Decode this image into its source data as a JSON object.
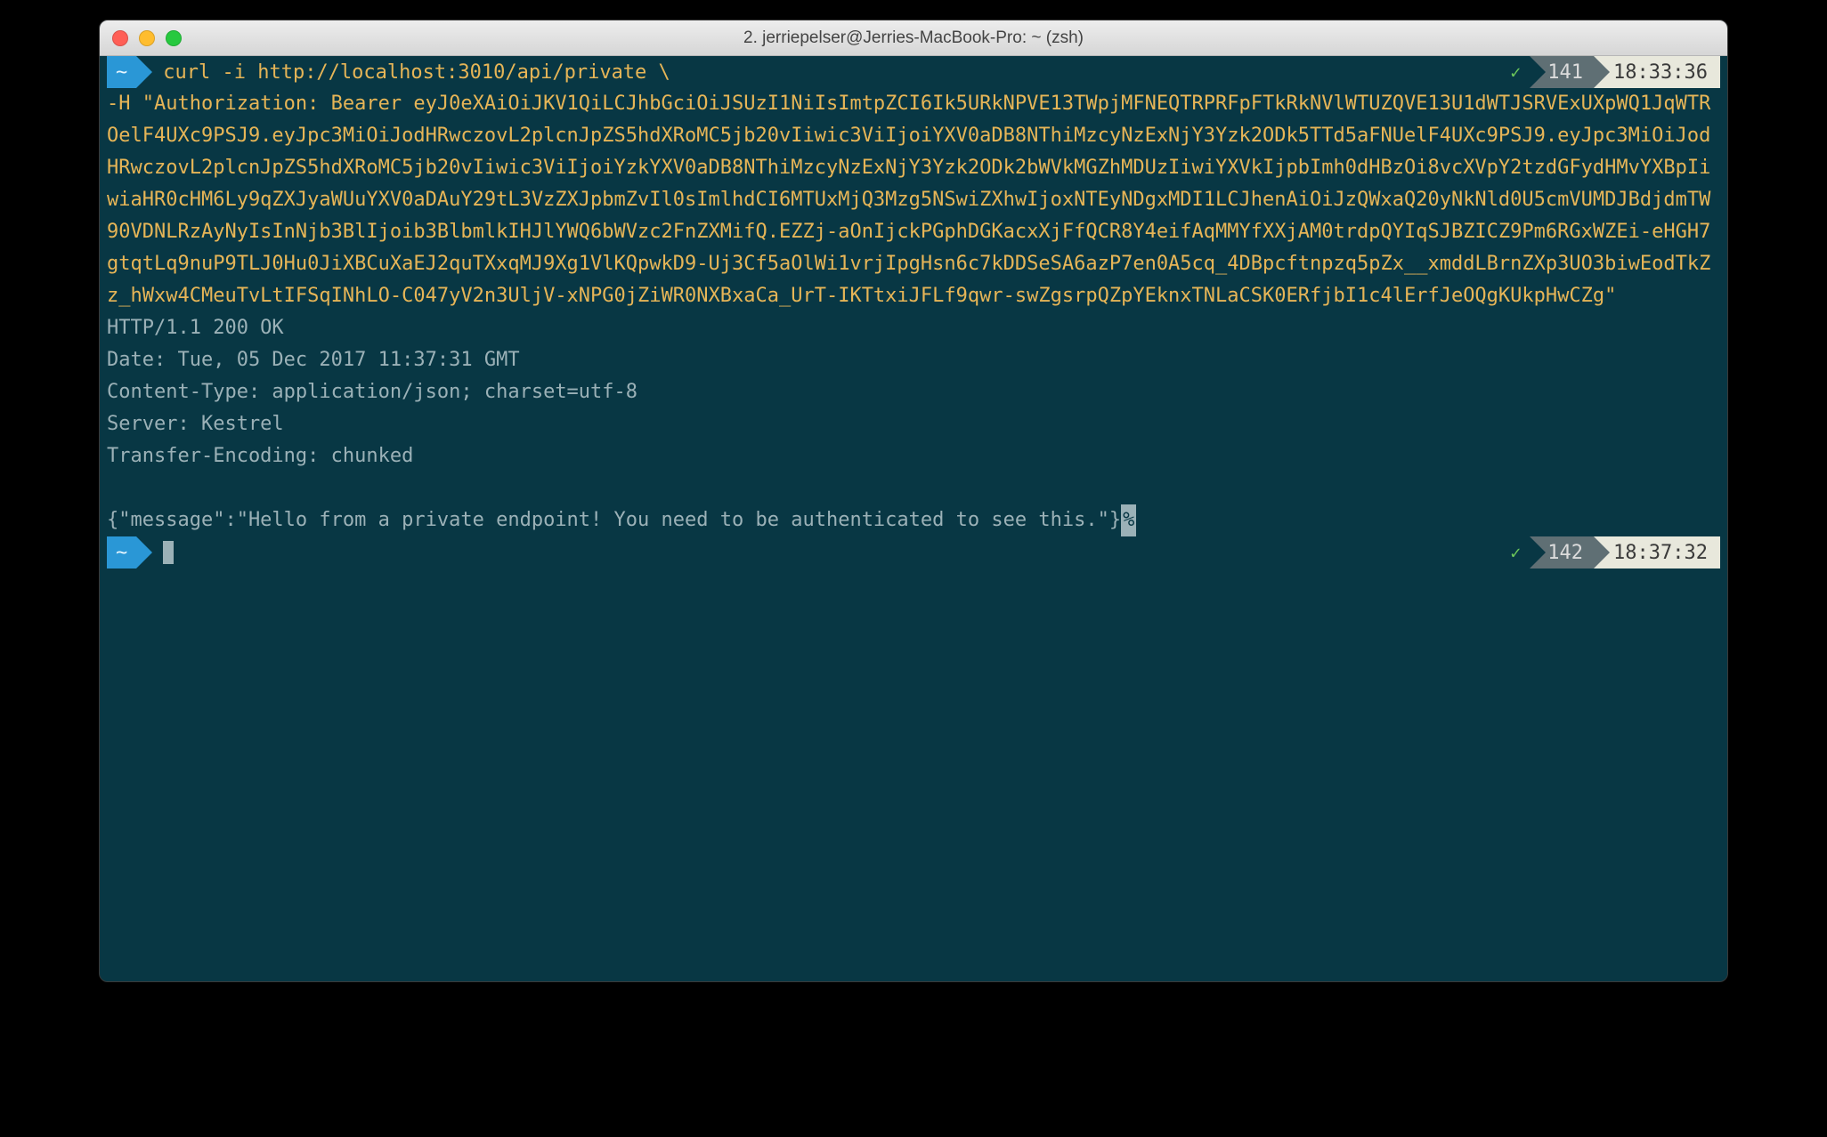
{
  "window": {
    "title": "2. jerriepelser@Jerries-MacBook-Pro: ~ (zsh)"
  },
  "prompt1": {
    "dir": "~",
    "cmd_prefix": "curl -i http://localhost:3010/api/private \\",
    "counter": "141",
    "time": "18:33:36"
  },
  "token_block": "-H \"Authorization: Bearer eyJ0eXAiOiJKV1QiLCJhbGciOiJSUzI1NiIsImtpZCI6Ik5URkNPVE13TWpjMFNEQTRPRFpFTkRkNVlWTUZQVE13U1dWTJSRVExUXpWQ1JqWTROelF4UXc9PSJ9.eyJpc3MiOiJodHRwczovL2plcnJpZS5hdXRoMC5jb20vIiwic3ViIjoiYXV0aDB8NThiMzcyNzExNjY3Yzk2ODk5TTd5aFNUelF4UXc9PSJ9.eyJpc3MiOiJodHRwczovL2plcnJpZS5hdXRoMC5jb20vIiwic3ViIjoiYzkYXV0aDB8NThiMzcyNzExNjY3Yzk2ODk2bWVkMGZhMDUzIiwiYXVkIjpbImh0dHBzOi8vcXVpY2tzdGFydHMvYXBpIiwiaHR0cHM6Ly9qZXJyaWUuYXV0aDAuY29tL3VzZXJpbmZvIl0sImlhdCI6MTUxMjQ3Mzg5NSwiZXhwIjoxNTEyNDgxMDI1LCJhenAiOiJzQWxaQ20yNkNld0U5cmVUMDJBdjdmTW90VDNLRzAyNyIsInNjb3BlIjoib3BlbmlkIHJlYWQ6bWVzc2FnZXMifQ.EZZj-aOnIjckPGphDGKacxXjFfQCR8Y4eifAqMMYfXXjAM0trdpQYIqSJBZICZ9Pm6RGxWZEi-eHGH7gtqtLq9nuP9TLJ0Hu0JiXBCuXaEJ2quTXxqMJ9Xg1VlKQpwkD9-Uj3Cf5aOlWi1vrjIpgHsn6c7kDDSeSA6azP7en0A5cq_4DBpcftnpzq5pZx__xmddLBrnZXp3UO3biwEodTkZz_hWxw4CMeuTvLtIFSqINhLO-C047yV2n3UljV-xNPG0jZiWR0NXBxaCa_UrT-IKTtxiJFLf9qwr-swZgsrpQZpYEknxTNLaCSK0ERfjbI1c4lErfJeOQgKUkpHwCZg\"",
  "response": {
    "status": "HTTP/1.1 200 OK",
    "date": "Date: Tue, 05 Dec 2017 11:37:31 GMT",
    "ctype": "Content-Type: application/json; charset=utf-8",
    "server": "Server: Kestrel",
    "tenc": "Transfer-Encoding: chunked",
    "body": "{\"message\":\"Hello from a private endpoint! You need to be authenticated to see this.\"}"
  },
  "prompt2": {
    "dir": "~",
    "counter": "142",
    "time": "18:37:32"
  }
}
